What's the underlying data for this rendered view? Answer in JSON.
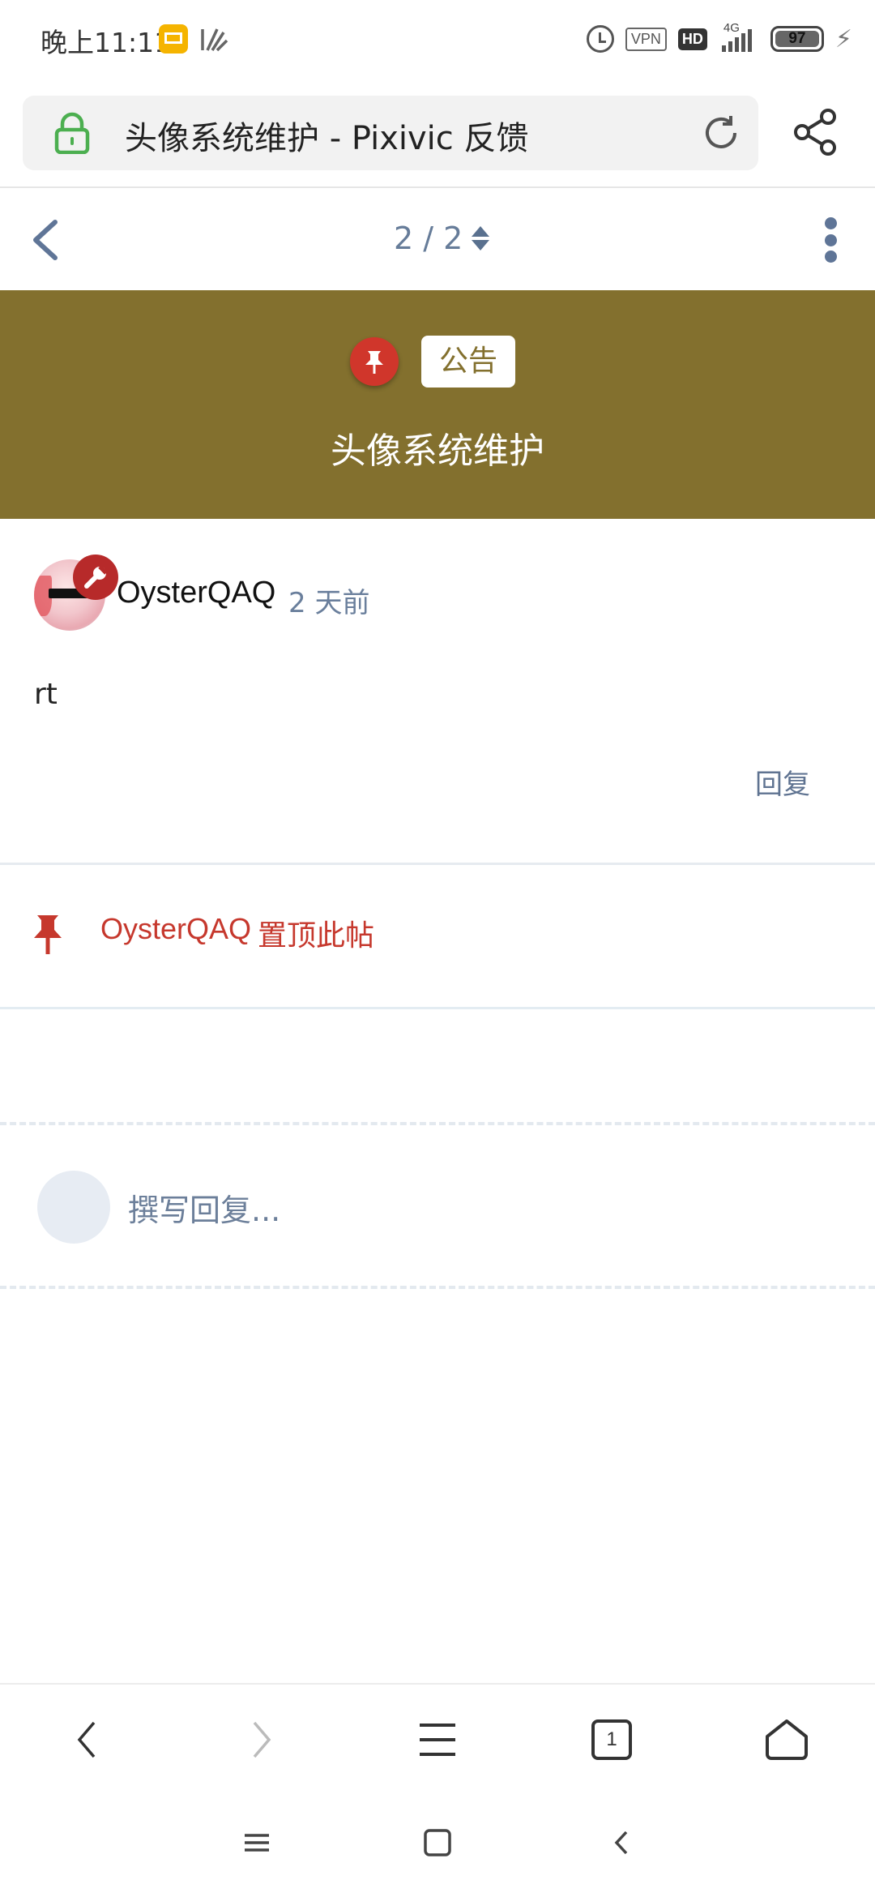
{
  "status_bar": {
    "time": "晚上11:11",
    "vpn_label": "VPN",
    "hd_label": "HD",
    "network": "4G",
    "battery": "97",
    "icons": [
      "mail-icon",
      "app-icon",
      "alarm-icon",
      "vpn-icon",
      "hd-icon",
      "signal-icon",
      "battery-icon",
      "charging-icon"
    ]
  },
  "address_bar": {
    "title": "头像系统维护 - Pixivic 反馈",
    "secure_icon": "lock-icon",
    "reload_icon": "reload-icon",
    "share_icon": "share-icon",
    "secure_color": "#4caf50"
  },
  "topic_nav": {
    "pager": "2 / 2"
  },
  "hero": {
    "tag": "公告",
    "title": "头像系统维护",
    "bg_color": "#83702e",
    "pin_color": "#d0362b"
  },
  "post": {
    "author": "OysterQAQ",
    "time": "2 天前",
    "body": "rt",
    "reply_label": "回复"
  },
  "event": {
    "user": "OysterQAQ",
    "action": "置顶此帖",
    "color": "#c6382d"
  },
  "composer": {
    "placeholder": "撰写回复..."
  },
  "browser_bar": {
    "tab_count": "1"
  }
}
